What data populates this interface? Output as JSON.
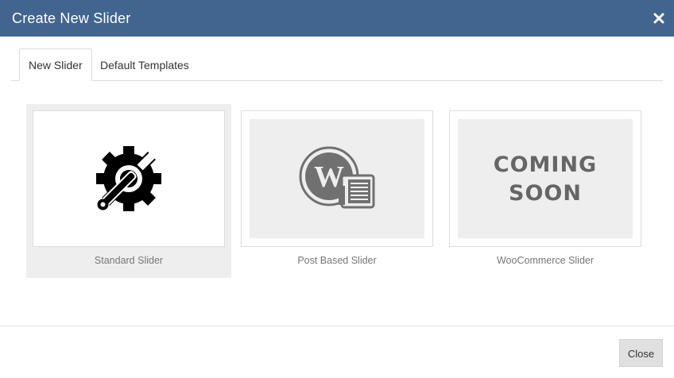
{
  "dialog": {
    "title": "Create New Slider",
    "close_icon": "close-icon"
  },
  "tabs": [
    {
      "label": "New Slider",
      "active": true
    },
    {
      "label": "Default Templates",
      "active": false
    }
  ],
  "options": [
    {
      "label": "Standard Slider",
      "icon": "gear-wrench-icon",
      "selected": true
    },
    {
      "label": "Post Based Slider",
      "icon": "wordpress-post-icon",
      "selected": false
    },
    {
      "label": "WooCommerce Slider",
      "icon": "coming-soon-badge",
      "selected": false,
      "badge_line1": "COMING",
      "badge_line2": "SOON"
    }
  ],
  "footer": {
    "close_label": "Close"
  },
  "colors": {
    "titlebar": "#41658e",
    "selected_bg": "#eeeeee",
    "placeholder_bg": "#eeeeee"
  }
}
